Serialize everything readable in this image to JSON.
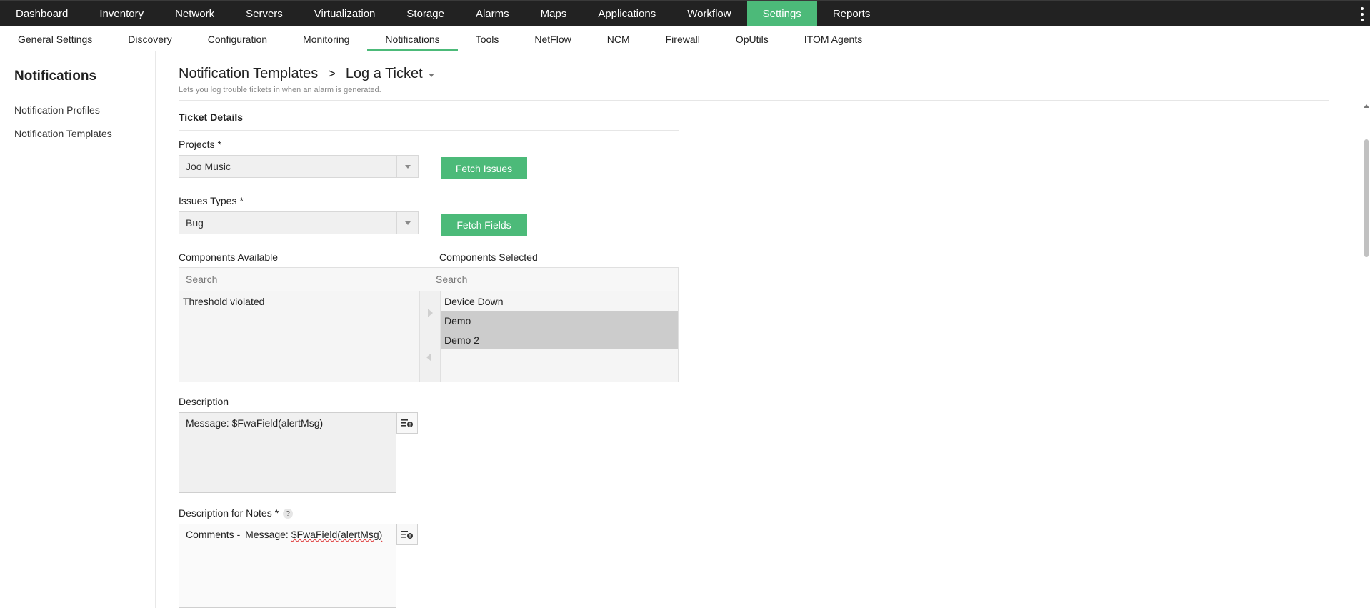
{
  "topnav": {
    "items": [
      "Dashboard",
      "Inventory",
      "Network",
      "Servers",
      "Virtualization",
      "Storage",
      "Alarms",
      "Maps",
      "Applications",
      "Workflow",
      "Settings",
      "Reports"
    ],
    "active": "Settings"
  },
  "subnav": {
    "items": [
      "General Settings",
      "Discovery",
      "Configuration",
      "Monitoring",
      "Notifications",
      "Tools",
      "NetFlow",
      "NCM",
      "Firewall",
      "OpUtils",
      "ITOM Agents"
    ],
    "active": "Notifications"
  },
  "sidebar": {
    "title": "Notifications",
    "links": [
      "Notification Profiles",
      "Notification Templates"
    ]
  },
  "header": {
    "crumb_parent": "Notification Templates",
    "crumb_separator": ">",
    "crumb_current": "Log a Ticket",
    "subtitle": "Lets you log trouble tickets in when an alarm is generated."
  },
  "form": {
    "section_title": "Ticket Details",
    "required_mark": "*",
    "projects": {
      "label": "Projects",
      "value": "Joo Music",
      "button": "Fetch Issues"
    },
    "issue_types": {
      "label": "Issues Types",
      "value": "Bug",
      "button": "Fetch Fields"
    },
    "components_available": {
      "label": "Components Available",
      "search_placeholder": "Search",
      "items": [
        "Threshold violated"
      ]
    },
    "components_selected": {
      "label": "Components Selected",
      "search_placeholder": "Search",
      "items": [
        "Device Down",
        "Demo",
        "Demo 2"
      ],
      "highlighted": [
        "Demo",
        "Demo 2"
      ]
    },
    "description": {
      "label": "Description",
      "value": "Message: $FwaField(alertMsg)"
    },
    "notes": {
      "label": "Description for Notes",
      "help": "?",
      "value_prefix": "Comments - ",
      "value_word": "Message: ",
      "value_misspelled": "$FwaField(alertMsg)"
    }
  },
  "colors": {
    "accent": "#4cba79",
    "topnav_bg": "#222222"
  }
}
